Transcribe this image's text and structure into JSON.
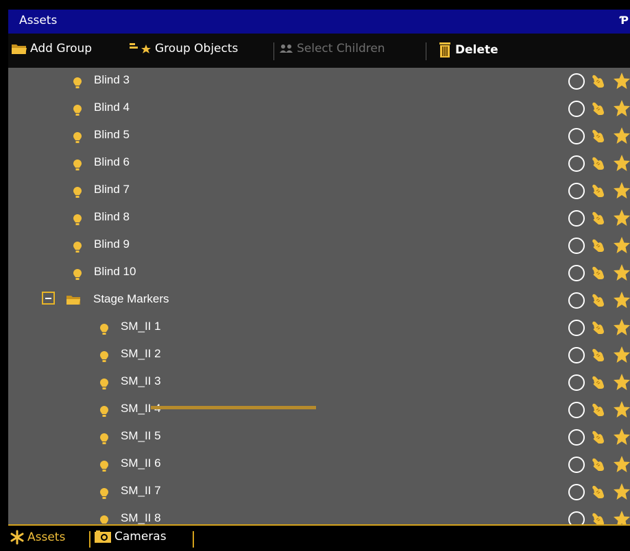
{
  "window": {
    "title": "Assets",
    "pin_icon": "pin-icon"
  },
  "toolbar": {
    "add_group": "Add Group",
    "group_objects": "Group Objects",
    "select_children": "Select Children",
    "delete": "Delete"
  },
  "tree": {
    "items": [
      {
        "label": "Blind 3",
        "type": "light",
        "level": 1
      },
      {
        "label": "Blind 4",
        "type": "light",
        "level": 1
      },
      {
        "label": "Blind 5",
        "type": "light",
        "level": 1
      },
      {
        "label": "Blind 6",
        "type": "light",
        "level": 1
      },
      {
        "label": "Blind 7",
        "type": "light",
        "level": 1
      },
      {
        "label": "Blind 8",
        "type": "light",
        "level": 1
      },
      {
        "label": "Blind 9",
        "type": "light",
        "level": 1
      },
      {
        "label": "Blind 10",
        "type": "light",
        "level": 1
      },
      {
        "label": "Stage Markers",
        "type": "group",
        "expanded": true,
        "level": 0
      },
      {
        "label": "SM_II 1",
        "type": "light",
        "level": 2
      },
      {
        "label": "SM_II 2",
        "type": "light",
        "level": 2
      },
      {
        "label": "SM_II 3",
        "type": "light",
        "level": 2
      },
      {
        "label": "SM_II 4",
        "type": "light",
        "level": 2
      },
      {
        "label": "SM_II 5",
        "type": "light",
        "level": 2
      },
      {
        "label": "SM_II 6",
        "type": "light",
        "level": 2
      },
      {
        "label": "SM_II 7",
        "type": "light",
        "level": 2
      },
      {
        "label": "SM_II 8",
        "type": "light",
        "level": 2
      }
    ],
    "row_icons": [
      "circle-icon",
      "hand-icon",
      "star-icon"
    ]
  },
  "tabs": [
    {
      "label": "Assets",
      "icon": "asterisk-icon",
      "active": true
    },
    {
      "label": "Cameras",
      "icon": "camera-icon",
      "active": false
    }
  ],
  "colors": {
    "title_bar": "#0a0a8c",
    "accent": "#f2bf3a",
    "tree_background": "#595959",
    "drop_indicator": "#b68b2c"
  }
}
